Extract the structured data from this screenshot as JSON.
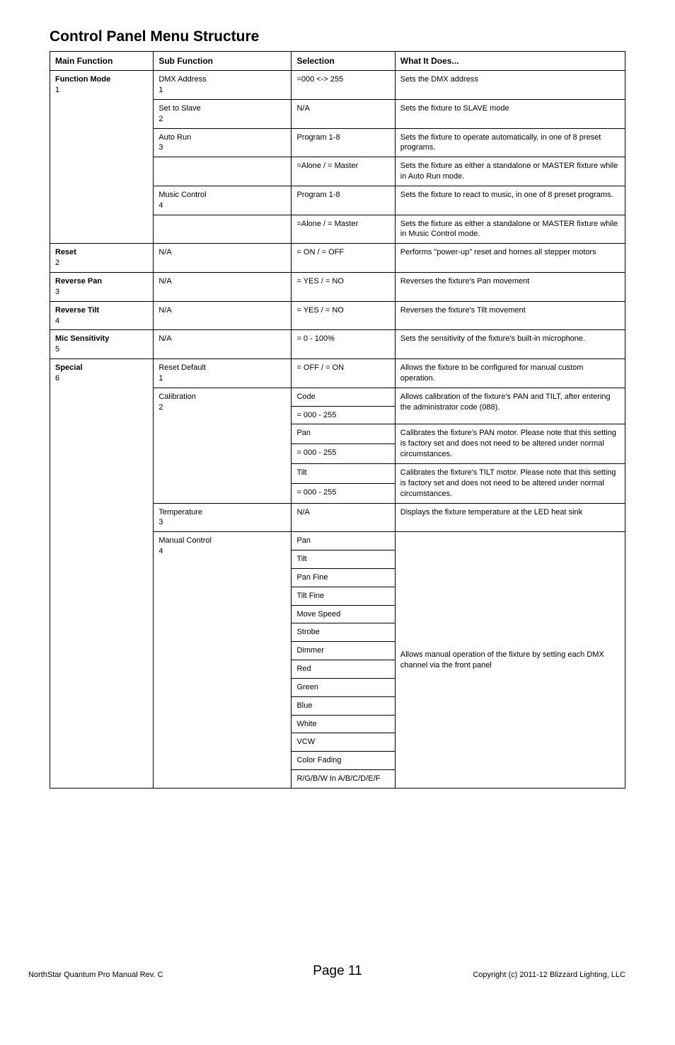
{
  "title": "Control Panel Menu Structure",
  "headers": {
    "main": "Main Function",
    "sub": "Sub Function",
    "sel": "Selection",
    "desc": "What It Does..."
  },
  "fm": {
    "label": "Function Mode",
    "num": "1",
    "dmx": {
      "label": "DMX Address",
      "num": "1",
      "sel": "=000 <-> 255",
      "desc": "Sets the DMX address"
    },
    "slave": {
      "label": "Set to Slave",
      "num": "2",
      "sel": "N/A",
      "desc": "Sets the fixture to SLAVE mode"
    },
    "auto": {
      "label": "Auto Run",
      "num": "3",
      "sel": "Program 1-8",
      "desc": "Sets the fixture to operate automatically, in one of 8 preset programs."
    },
    "auto2": {
      "sel": "=Alone / = Master",
      "desc": "Sets the fixture as either a standalone or MASTER fixture while in Auto Run mode."
    },
    "music": {
      "label": "Music Control",
      "num": "4",
      "sel": "Program 1-8",
      "desc": "Sets the fixture to react to music, in one of 8 preset programs."
    },
    "music2": {
      "sel": "=Alone / = Master",
      "desc": "Sets the fixture as either a standalone or MASTER fixture while in Music Control mode."
    }
  },
  "reset": {
    "label": "Reset",
    "num": "2",
    "sub": "N/A",
    "sel": "= ON / = OFF",
    "desc": "Performs \"power-up\" reset and homes all stepper motors"
  },
  "revpan": {
    "label": "Reverse Pan",
    "num": "3",
    "sub": "N/A",
    "sel": "= YES / = NO",
    "desc": "Reverses the fixture's Pan movement"
  },
  "revtilt": {
    "label": "Reverse Tilt",
    "num": "4",
    "sub": "N/A",
    "sel": "= YES / = NO",
    "desc": "Reverses the fixture's Tilt movement"
  },
  "mic": {
    "label": "Mic Sensitivity",
    "num": "5",
    "sub": "N/A",
    "sel": "= 0 - 100%",
    "desc": "Sets the sensitivity of the fixture's built-in microphone."
  },
  "special": {
    "label": "Special",
    "num": "6",
    "rd": {
      "label": "Reset Default",
      "num": "1",
      "sel": "= OFF / = ON",
      "desc": "Allows the fixture to be configured for manual custom operation."
    },
    "cal": {
      "label": "Calibration",
      "num": "2",
      "code": {
        "sel": "Code",
        "range": "= 000 - 255",
        "desc": "Allows calibration of the fixture's PAN and TILT, after entering the administrator code (088)."
      },
      "pan": {
        "sel": "Pan",
        "range": "= 000 - 255",
        "desc": "Calibrates the fixture's PAN motor.  Please note that this setting is factory set and does not need to be altered under normal circumstances."
      },
      "tilt": {
        "sel": "Tilt",
        "range": "= 000 - 255",
        "desc": "Calibrates the fixture's TILT motor.  Please note that this setting is factory set and does not need to be altered under normal circumstances."
      }
    },
    "temp": {
      "label": "Temperature",
      "num": "3",
      "sel": "N/A",
      "desc": "Displays the fixture temperature at the LED heat sink"
    },
    "manual": {
      "label": "Manual Control",
      "num": "4",
      "desc": "Allows manual operation of the fixture by setting each DMX channel via the front panel",
      "items": {
        "i0": "Pan",
        "i1": "Tilt",
        "i2": "Pan Fine",
        "i3": "Tilt Fine",
        "i4": "Move Speed",
        "i5": "Strobe",
        "i6": "Dimmer",
        "i7": "Red",
        "i8": "Green",
        "i9": "Blue",
        "i10": "White",
        "i11": "VCW",
        "i12": "Color Fading",
        "i13": "R/G/B/W In A/B/C/D/E/F"
      }
    }
  },
  "footer": {
    "left": "NorthStar Quantum Pro Manual Rev. C",
    "center": "Page 11",
    "right": "Copyright (c) 2011-12 Blizzard Lighting, LLC"
  }
}
